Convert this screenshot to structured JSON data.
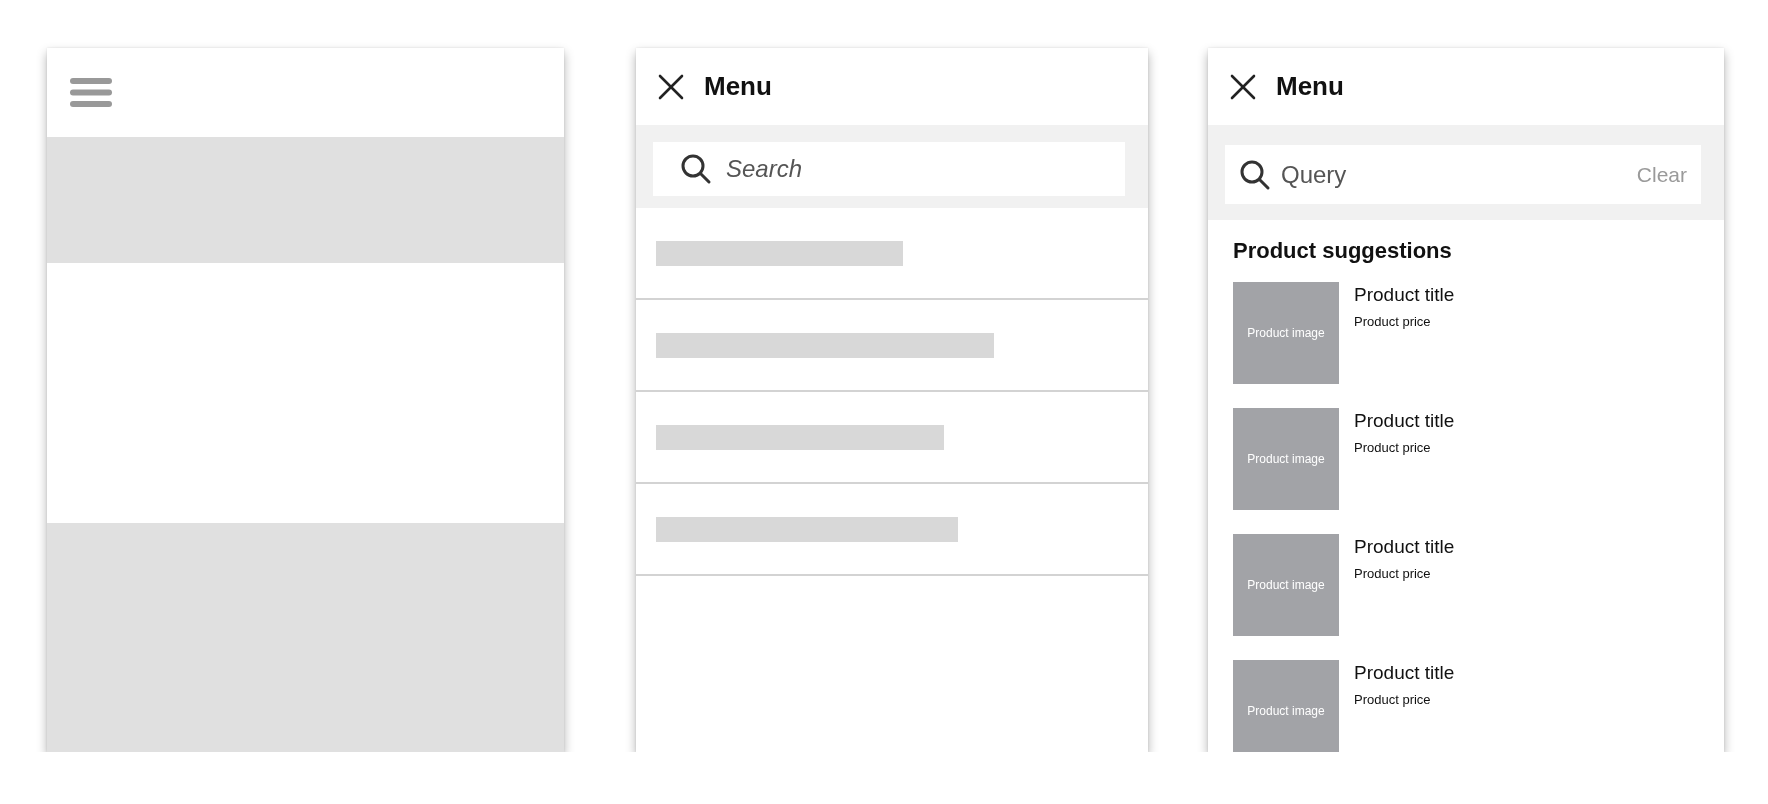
{
  "screens": [
    {
      "kind": "closed"
    },
    {
      "kind": "menu",
      "title": "Menu",
      "search": {
        "placeholder": "Search"
      }
    },
    {
      "kind": "suggestions",
      "title": "Menu",
      "search": {
        "value": "Query",
        "clear": "Clear"
      },
      "section_title": "Product suggestions",
      "products": [
        {
          "image": "Product image",
          "title": "Product title",
          "price": "Product price"
        },
        {
          "image": "Product image",
          "title": "Product title",
          "price": "Product price"
        },
        {
          "image": "Product image",
          "title": "Product title",
          "price": "Product price"
        },
        {
          "image": "Product image",
          "title": "Product title",
          "price": "Product price"
        }
      ]
    }
  ]
}
